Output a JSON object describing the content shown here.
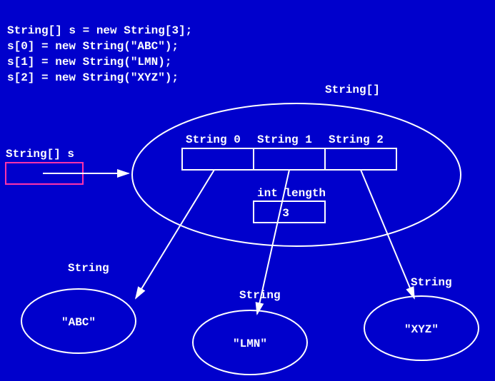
{
  "code": {
    "line1": "String[] s = new String[3];",
    "line2": "s[0] = new String(\"ABC\");",
    "line3": "s[1] = new String(\"LMN);",
    "line4": "s[2] = new String(\"XYZ\");"
  },
  "labels": {
    "var_decl": "String[] s",
    "array_type": "String[]",
    "slot0": "String 0",
    "slot1": "String 1",
    "slot2": "String 2",
    "length_label": "int length",
    "length_value": "3",
    "obj_type": "String",
    "val0": "\"ABC\"",
    "val1": "\"LMN\"",
    "val2": "\"XYZ\""
  },
  "colors": {
    "bg": "#0000cc",
    "fg": "#ffffff",
    "accent": "#ff33aa"
  }
}
